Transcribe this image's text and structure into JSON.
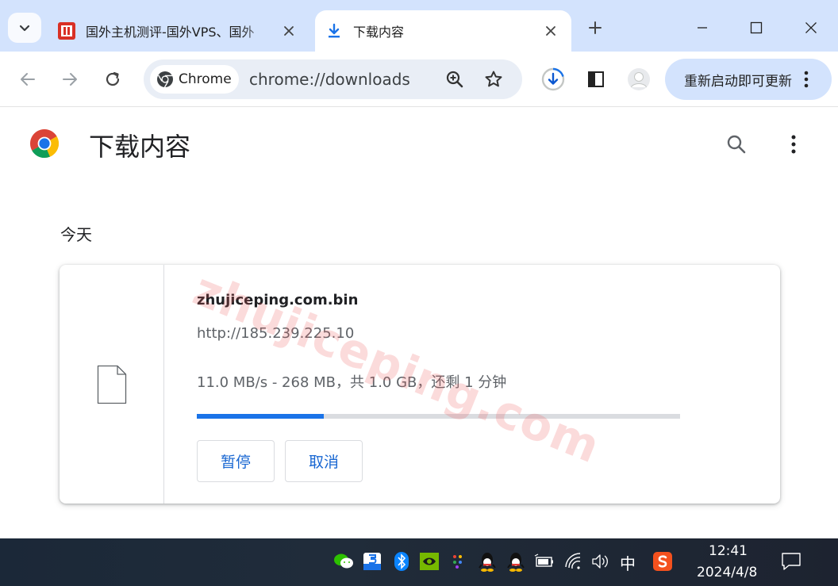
{
  "tabs": [
    {
      "title": "国外主机测评-国外VPS、国外",
      "icon": "site-favicon"
    },
    {
      "title": "下载内容",
      "icon": "download-icon",
      "active": true
    }
  ],
  "toolbar": {
    "chip_label": "Chrome",
    "url": "chrome://downloads",
    "update_label": "重新启动即可更新"
  },
  "page": {
    "title": "下载内容",
    "section": "今天"
  },
  "download": {
    "file_name": "zhujiceping.com.bin",
    "source_url": "http://185.239.225.10",
    "status": "11.0 MB/s - 268 MB，共 1.0 GB，还剩 1 分钟",
    "progress": 0.262,
    "pause_label": "暂停",
    "cancel_label": "取消"
  },
  "watermark": "zhujiceping.com",
  "taskbar": {
    "ime": "中",
    "time": "12:41",
    "date": "2024/4/8"
  },
  "colors": {
    "tabstrip": "#d3e3fd",
    "accent": "#1a73e8",
    "button_text": "#1967d2"
  }
}
